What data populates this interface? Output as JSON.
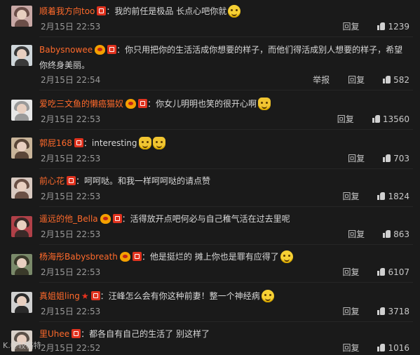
{
  "comments": [
    {
      "username": "顺着我方向too",
      "badges": [
        "red"
      ],
      "text": "：我的前任是极品 长点心吧你就",
      "emoji_count": 1,
      "time": "2月15日 22:53",
      "actions": [
        "回复"
      ],
      "likes": "1239",
      "avatar_colors": [
        "#c9a9a6",
        "#6b4e48"
      ]
    },
    {
      "username": "Babysnowee",
      "badges": [
        "vip",
        "red"
      ],
      "text": "：你只用把你的生活活成你想要的样子，而他们得活成别人想要的样子，希望你终身美丽。",
      "emoji_count": 0,
      "time": "2月15日 22:54",
      "actions": [
        "举报",
        "回复"
      ],
      "likes": "582",
      "avatar_colors": [
        "#cfd6da",
        "#3a3a3a"
      ]
    },
    {
      "username": "爱吃三文鱼的懒癌猫奴",
      "badges": [
        "vip",
        "red"
      ],
      "text": "：你女儿明明也笑的很开心啊",
      "emoji_count": 1,
      "time": "2月15日 22:53",
      "actions": [
        "回复"
      ],
      "likes": "13560",
      "avatar_colors": [
        "#e8e8e8",
        "#9a9a9a"
      ]
    },
    {
      "username": "郭屁168",
      "badges": [
        "red"
      ],
      "text": "：interesting",
      "emoji_count": 2,
      "time": "2月15日 22:53",
      "actions": [
        "回复"
      ],
      "likes": "703",
      "avatar_colors": [
        "#c9b59a",
        "#5a4638"
      ]
    },
    {
      "username": "前心花",
      "badges": [
        "red"
      ],
      "text": "：呵呵哒。和我一样呵呵哒的请点赞",
      "emoji_count": 0,
      "time": "2月15日 22:53",
      "actions": [
        "回复"
      ],
      "likes": "1824",
      "avatar_colors": [
        "#d8c9c0",
        "#6a5045"
      ]
    },
    {
      "username": "遥远的他_Bella",
      "badges": [
        "vip",
        "red"
      ],
      "text": "：活得放开点吧何必与自己稚气活在过去里呢",
      "emoji_count": 0,
      "time": "2月15日 22:53",
      "actions": [
        "回复"
      ],
      "likes": "863",
      "avatar_colors": [
        "#b04048",
        "#3a2a28"
      ]
    },
    {
      "username": "杨海彤Babysbreath",
      "badges": [
        "vip",
        "red"
      ],
      "text": "：他是挺烂的 摊上你也是罪有应得了",
      "emoji_count": 1,
      "time": "2月15日 22:53",
      "actions": [
        "回复"
      ],
      "likes": "6107",
      "avatar_colors": [
        "#7a8a6a",
        "#3a3a2a"
      ]
    },
    {
      "username": "真姐姐ling",
      "badges": [
        "star",
        "red"
      ],
      "text": "：汪峰怎么会有你这种前妻！整一个神经病",
      "emoji_count": 1,
      "time": "2月15日 22:53",
      "actions": [
        "回复"
      ],
      "likes": "3718",
      "avatar_colors": [
        "#d0d0d0",
        "#2a2a2a"
      ]
    },
    {
      "username": "里Uhee",
      "badges": [
        "red"
      ],
      "text": "：都各自有自己的生活了 别这样了",
      "emoji_count": 0,
      "time": "2月15日 22:52",
      "actions": [
        "回复"
      ],
      "likes": "1016",
      "avatar_colors": [
        "#d8d0c8",
        "#5a5048"
      ]
    }
  ],
  "watermark": "K.Ⓢ较格特"
}
